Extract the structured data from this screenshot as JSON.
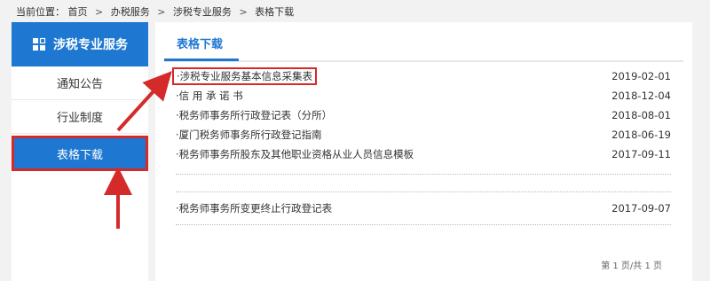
{
  "breadcrumb": {
    "prefix": "当前位置：",
    "items": [
      "首页",
      "办税服务",
      "涉税专业服务",
      "表格下载"
    ],
    "separator": ">"
  },
  "sidebar": {
    "title": "涉税专业服务",
    "items": [
      {
        "label": "通知公告",
        "active": false
      },
      {
        "label": "行业制度",
        "active": false
      },
      {
        "label": "表格下载",
        "active": true
      }
    ]
  },
  "main": {
    "tab_title": "表格下载",
    "rows": [
      {
        "title": "涉税专业服务基本信息采集表",
        "date": "2019-02-01",
        "highlighted": true
      },
      {
        "title": "信 用 承 诺 书",
        "date": "2018-12-04",
        "highlighted": false
      },
      {
        "title": "税务师事务所行政登记表（分所）",
        "date": "2018-08-01",
        "highlighted": false
      },
      {
        "title": "厦门税务师事务所行政登记指南",
        "date": "2018-06-19",
        "highlighted": false
      },
      {
        "title": "税务师事务所股东及其他职业资格从业人员信息模板",
        "date": "2017-09-11",
        "highlighted": false
      },
      {
        "title": "税务师事务所变更终止行政登记表",
        "date": "2017-09-07",
        "highlighted": false
      }
    ],
    "bullet": "·",
    "pagination": "第 1 页/共 1 页"
  },
  "colors": {
    "accent": "#1e78d1",
    "highlight": "#d42a2a"
  }
}
